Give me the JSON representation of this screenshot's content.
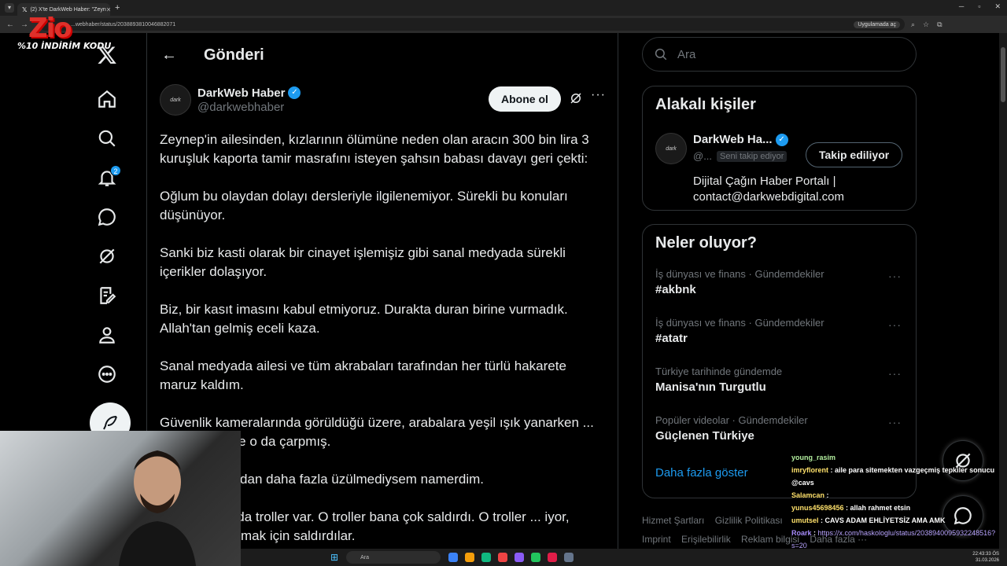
{
  "browser": {
    "tab_title": "(2) X'te DarkWeb Haber: \"Zeyn",
    "url": "...webhaber/status/2038893810046882071",
    "open_in_app": "Uygulamada aç"
  },
  "overlay": {
    "logo_text": "Zio",
    "promo": "%10 İNDİRİM KODU"
  },
  "nav": {
    "notifications_badge": "2"
  },
  "main": {
    "title": "Gönderi",
    "author_name": "DarkWeb Haber",
    "author_handle": "@darkwebhaber",
    "avatar_text": "dark",
    "subscribe_label": "Abone ol",
    "paragraphs": [
      "Zeynep'in ailesinden, kızlarının ölümüne neden olan aracın 300 bin lira 3 kuruşluk kaporta tamir masrafını isteyen şahsın babası davayı geri çekti:",
      "Oğlum bu olaydan dolayı dersleriyle ilgilenemiyor. Sürekli bu konuları düşünüyor.",
      "Sanki biz kasti olarak bir cinayet işlemişiz gibi sanal medyada sürekli içerikler dolaşıyor.",
      "Biz, bir kasıt imasını kabul etmiyoruz. Durakta duran birine vurmadık. Allah'tan gelmiş eceli kaza.",
      "Sanal medyada ailesi ve tüm akrabaları tarafından her türlü hakarete maruz kaldım.",
      "Güvenlik kameralarında görüldüğü üzere, arabalara yeşil ışık yanarken ... e atlanılmış ve o da çarpmış.",
      "... aydı. Onlardan daha fazla üzülmediysem namerdim.",
      "... hesaplarında troller var. O troller bana çok saldırdı. O troller ... iyor, kargaşa yaratmak için saldırdılar."
    ]
  },
  "right": {
    "search_placeholder": "Ara",
    "related_title": "Alakalı kişiler",
    "related_name": "DarkWeb Ha...",
    "related_handle": "@...",
    "follows_you": "Seni takip ediyor",
    "following_label": "Takip ediliyor",
    "related_bio": "Dijital Çağın Haber Portalı | contact@darkwebdigital.com",
    "trends_title": "Neler oluyor?",
    "trends": [
      {
        "meta": "İş dünyası ve finans · Gündemdekiler",
        "name": "#akbnk"
      },
      {
        "meta": "İş dünyası ve finans · Gündemdekiler",
        "name": "#atatr"
      },
      {
        "meta": "Türkiye tarihinde gündemde",
        "name": "Manisa'nın Turgutlu"
      },
      {
        "meta": "Popüler videolar · Gündemdekiler",
        "name": "Güçlenen Türkiye"
      }
    ],
    "show_more": "Daha fazla göster",
    "footer": [
      "Hizmet Şartları",
      "Gizlilik Politikası",
      "Imprint",
      "Erişilebilirlik",
      "Reklam bilgisi",
      "Daha fazla ···"
    ]
  },
  "chat": [
    {
      "user": "young_rasim",
      "msg": ""
    },
    {
      "user": "imryflorent",
      "msg": "aile para sitemekten vazgeçmiş tepkiler sonucu @cavs"
    },
    {
      "user": "Salamcan",
      "msg": ""
    },
    {
      "user": "yunus45698456",
      "msg": "allah rahmet etsin"
    },
    {
      "user": "umutsel",
      "msg": "CAVS ADAM EHLİYETSİZ AMA AMK"
    },
    {
      "user": "Roark",
      "msg": "https://x.com/haskologlu/status/2038940095932248516?s=20"
    }
  ],
  "taskbar": {
    "search_placeholder": "Ara",
    "time": "22:43:33 ÖS",
    "date": "31.03.2026"
  }
}
